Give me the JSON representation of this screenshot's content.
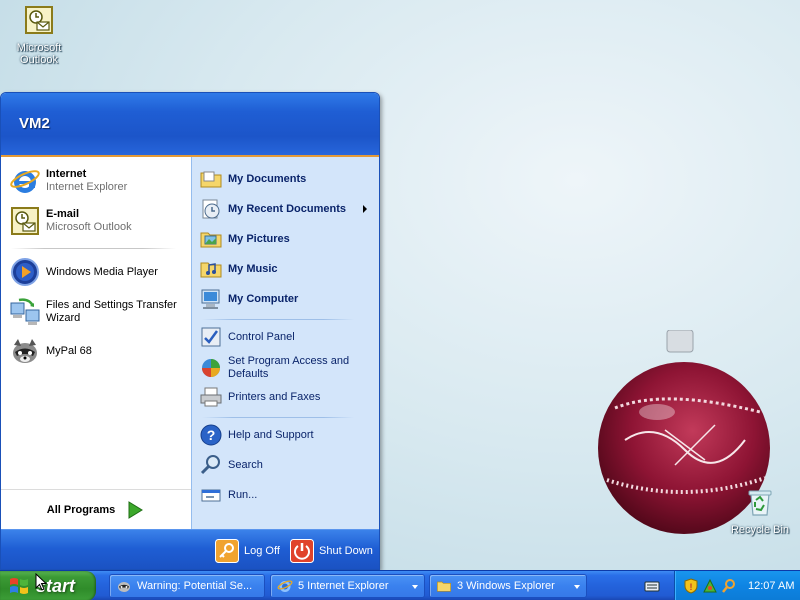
{
  "desktop": {
    "icons": [
      {
        "label_line1": "Microsoft",
        "label_line2": "Outlook",
        "icon": "outlook-icon"
      },
      {
        "label": "Recycle Bin",
        "icon": "recycle-bin-icon"
      }
    ]
  },
  "start_menu": {
    "user_name": "VM2",
    "pinned": [
      {
        "title": "Internet",
        "subtitle": "Internet Explorer",
        "icon": "internet-explorer-icon"
      },
      {
        "title": "E-mail",
        "subtitle": "Microsoft Outlook",
        "icon": "outlook-icon"
      }
    ],
    "recent": [
      {
        "line1": "Windows Media Player",
        "line2": "",
        "icon": "media-player-icon"
      },
      {
        "line1": "Files and Settings Transfer",
        "line2": "Wizard",
        "icon": "transfer-wizard-icon"
      },
      {
        "line1": "MyPal 68",
        "line2": "",
        "icon": "mypal-icon"
      }
    ],
    "all_programs": "All Programs",
    "places": [
      {
        "label": "My Documents",
        "icon": "folder-icon"
      },
      {
        "label": "My Recent Documents",
        "icon": "recent-documents-icon"
      },
      {
        "label": "My Pictures",
        "icon": "pictures-folder-icon"
      },
      {
        "label": "My Music",
        "icon": "music-folder-icon"
      },
      {
        "label": "My Computer",
        "icon": "computer-icon"
      }
    ],
    "settings": [
      {
        "line1": "Control Panel",
        "line2": "",
        "icon": "control-panel-icon"
      },
      {
        "line1": "Set Program Access and",
        "line2": "Defaults",
        "icon": "program-access-icon"
      },
      {
        "line1": "Printers and Faxes",
        "line2": "",
        "icon": "printer-icon"
      }
    ],
    "tools": [
      {
        "label": "Help and Support",
        "icon": "help-icon"
      },
      {
        "label": "Search",
        "icon": "search-icon"
      },
      {
        "label": "Run...",
        "icon": "run-icon"
      }
    ],
    "log_off": "Log Off",
    "shut_down": "Shut Down"
  },
  "taskbar": {
    "start_label": "start",
    "buttons": [
      {
        "label": "Warning: Potential Se...",
        "icon": "mypal-icon"
      },
      {
        "label": "5 Internet Explorer",
        "icon": "internet-explorer-icon"
      },
      {
        "label": "3 Windows Explorer",
        "icon": "folder-icon"
      }
    ],
    "clock": "12:07 AM"
  },
  "colors": {
    "start_menu_blue": "#1f5ed4",
    "right_pane": "#d3e5fa",
    "start_green": "#3c9a35",
    "tray_blue": "#0e84e3"
  }
}
